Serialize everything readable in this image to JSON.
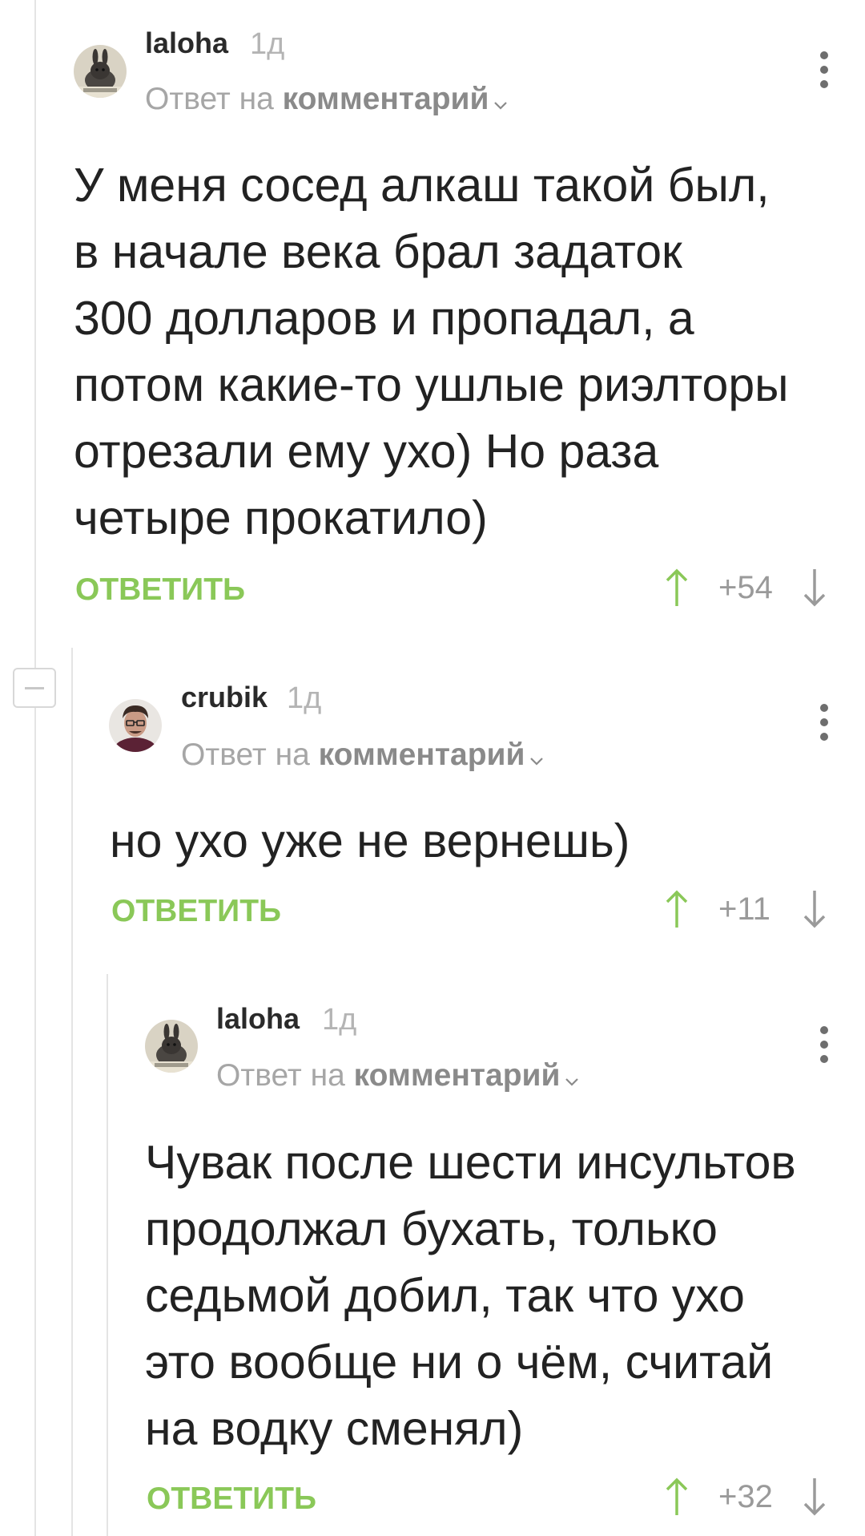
{
  "comments": [
    {
      "username": "laloha",
      "time": "1д",
      "reply_prefix": "Ответ на",
      "reply_link": "комментарий",
      "lines": [
        "У меня сосед алкаш такой был,",
        "в начале века брал задаток",
        "300 долларов и пропадал, а",
        "потом какие-то ушлые риэлторы",
        "отрезали ему ухо) Но раза",
        "четыре прокатило)"
      ],
      "reply_label": "ОТВЕТИТЬ",
      "score": "+54",
      "avatar_icon": "rabbit-avatar"
    },
    {
      "username": "crubik",
      "time": "1д",
      "reply_prefix": "Ответ на",
      "reply_link": "комментарий",
      "lines": [
        "но ухо уже не вернешь)"
      ],
      "reply_label": "ОТВЕТИТЬ",
      "score": "+11",
      "avatar_icon": "man-avatar"
    },
    {
      "username": "laloha",
      "time": "1д",
      "reply_prefix": "Ответ на",
      "reply_link": "комментарий",
      "lines": [
        "Чувак после шести инсультов",
        "продолжал бухать, только",
        "седьмой добил, так что ухо",
        "это вообще ни о чём, считай",
        "на водку сменял)"
      ],
      "reply_label": "ОТВЕТИТЬ",
      "score": "+32",
      "avatar_icon": "rabbit-avatar"
    }
  ],
  "colors": {
    "accent_green": "#8ac858",
    "thread_line": "#e4e4e4",
    "text": "#222222",
    "muted": "#a6a6a6"
  }
}
